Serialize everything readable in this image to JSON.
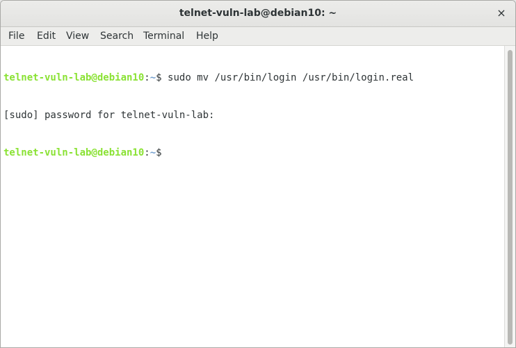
{
  "window": {
    "title": "telnet-vuln-lab@debian10: ~",
    "close_label": "×"
  },
  "menu": {
    "items": [
      {
        "label": "File"
      },
      {
        "label": "Edit"
      },
      {
        "label": "View"
      },
      {
        "label": "Search"
      },
      {
        "label": "Terminal"
      },
      {
        "label": "Help"
      }
    ]
  },
  "terminal": {
    "prompt": {
      "user_host": "telnet-vuln-lab@debian10",
      "separator": ":",
      "path": "~",
      "symbol": "$"
    },
    "lines": [
      {
        "command": " sudo mv /usr/bin/login /usr/bin/login.real"
      },
      {
        "output": "[sudo] password for telnet-vuln-lab:"
      },
      {
        "command": ""
      }
    ]
  },
  "colors": {
    "prompt_user": "#8ae234",
    "prompt_path": "#729fcf",
    "text": "#2e3436",
    "background": "#ffffff"
  }
}
